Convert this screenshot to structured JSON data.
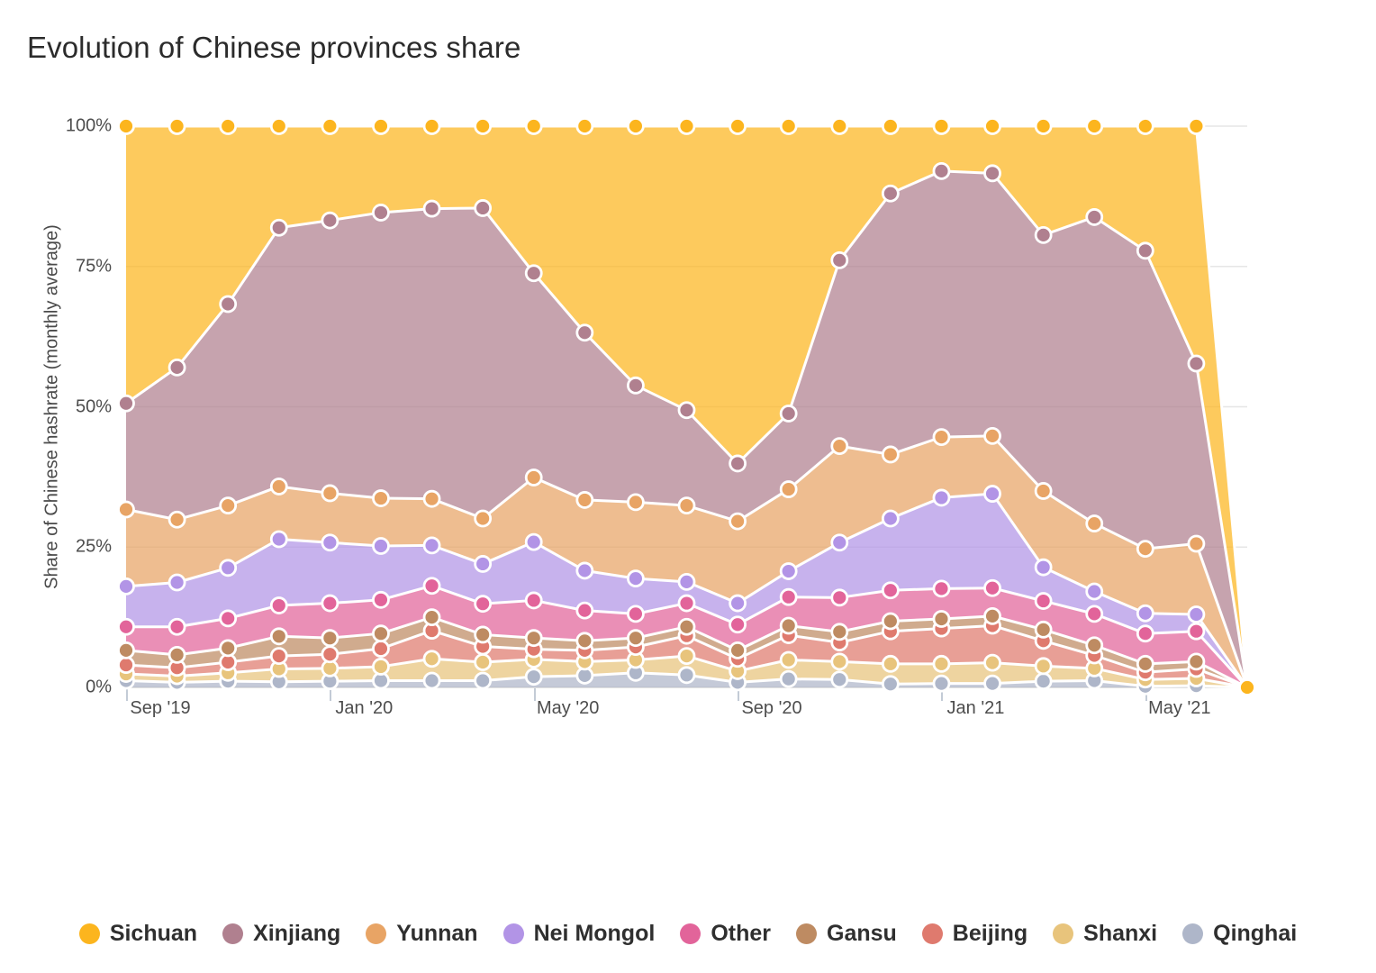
{
  "title": "Evolution of Chinese provinces share",
  "axes": {
    "y_title": "Share of Chinese hashrate (monthly average)",
    "y_ticks": [
      "0%",
      "25%",
      "50%",
      "75%",
      "100%"
    ],
    "x_ticks": [
      "Sep '19",
      "Jan '20",
      "May '20",
      "Sep '20",
      "Jan '21",
      "May '21"
    ]
  },
  "legend": [
    {
      "label": "Sichuan",
      "color": "#FCB51E"
    },
    {
      "label": "Xinjiang",
      "color": "#B0808F"
    },
    {
      "label": "Yunnan",
      "color": "#E8A465"
    },
    {
      "label": "Nei Mongol",
      "color": "#B294E6"
    },
    {
      "label": "Other",
      "color": "#E2649A"
    },
    {
      "label": "Gansu",
      "color": "#BE8B62"
    },
    {
      "label": "Beijing",
      "color": "#DF7A6E"
    },
    {
      "label": "Shanxi",
      "color": "#E8C47C"
    },
    {
      "label": "Qinghai",
      "color": "#AEB6C9"
    }
  ],
  "chart_data": {
    "type": "area",
    "stacked": true,
    "title": "Evolution of Chinese provinces share",
    "xlabel": "",
    "ylabel": "Share of Chinese hashrate (monthly average)",
    "ylim": [
      0,
      100
    ],
    "y_ticks": [
      0,
      25,
      50,
      75,
      100
    ],
    "grid": true,
    "legend_position": "bottom",
    "x": [
      "Sep '19",
      "Oct '19",
      "Nov '19",
      "Dec '19",
      "Jan '20",
      "Feb '20",
      "Mar '20",
      "Apr '20",
      "May '20",
      "Jun '20",
      "Jul '20",
      "Aug '20",
      "Sep '20",
      "Oct '20",
      "Nov '20",
      "Dec '20",
      "Jan '21",
      "Feb '21",
      "Mar '21",
      "Apr '21",
      "May '21",
      "Jun '21",
      "Jul '21"
    ],
    "stack_order_bottom_to_top": [
      "Qinghai",
      "Shanxi",
      "Beijing",
      "Gansu",
      "Other",
      "Nei Mongol",
      "Yunnan",
      "Xinjiang",
      "Sichuan"
    ],
    "series": [
      {
        "name": "Sichuan",
        "color": "#FCB51E",
        "values": [
          49.4,
          43.0,
          31.7,
          18.1,
          16.8,
          15.4,
          14.7,
          14.6,
          26.2,
          43.8,
          52.2,
          50.6,
          60.1,
          51.2,
          23.9,
          12.0,
          8.0,
          8.4,
          9.4,
          16.2,
          22.2,
          42.3,
          0.0
        ]
      },
      {
        "name": "Xinjiang",
        "color": "#B0808F",
        "values": [
          18.9,
          27.1,
          35.9,
          46.1,
          48.6,
          50.9,
          51.7,
          55.3,
          46.4,
          29.8,
          20.8,
          17.0,
          10.3,
          13.5,
          33.1,
          46.5,
          47.4,
          46.8,
          45.6,
          54.6,
          53.1,
          32.1,
          0.0
        ]
      },
      {
        "name": "Yunnan",
        "color": "#E8A465",
        "values": [
          13.7,
          11.2,
          11.1,
          9.4,
          8.8,
          8.5,
          8.3,
          8.1,
          11.5,
          12.6,
          13.6,
          13.6,
          14.6,
          14.6,
          17.2,
          11.4,
          10.8,
          10.3,
          13.6,
          12.1,
          11.5,
          12.6,
          0.0
        ]
      },
      {
        "name": "Nei Mongol",
        "color": "#B294E6",
        "values": [
          7.2,
          7.9,
          9.0,
          11.8,
          10.8,
          9.6,
          7.2,
          7.1,
          10.4,
          7.1,
          6.3,
          3.8,
          3.8,
          4.6,
          9.8,
          12.8,
          16.2,
          16.8,
          6.0,
          4.0,
          3.6,
          3.0,
          0.0
        ]
      },
      {
        "name": "Other",
        "color": "#E2649A",
        "values": [
          4.2,
          5.0,
          5.3,
          5.5,
          6.2,
          6.0,
          5.6,
          5.5,
          6.7,
          5.4,
          4.3,
          4.2,
          4.6,
          5.1,
          6.1,
          5.5,
          5.4,
          5.0,
          5.1,
          5.6,
          5.4,
          5.4,
          0.0
        ]
      },
      {
        "name": "Gansu",
        "color": "#BE8B62",
        "values": [
          2.6,
          2.3,
          2.5,
          3.5,
          2.9,
          2.7,
          2.4,
          2.1,
          2.0,
          1.7,
          1.6,
          1.6,
          1.5,
          1.7,
          1.9,
          1.8,
          1.7,
          1.7,
          2.0,
          1.8,
          1.5,
          1.3,
          0.0
        ]
      },
      {
        "name": "Beijing",
        "color": "#DF7A6E",
        "values": [
          1.6,
          1.5,
          1.9,
          2.3,
          2.5,
          3.2,
          5.0,
          2.8,
          1.8,
          2.0,
          2.3,
          3.6,
          2.2,
          4.4,
          3.4,
          5.8,
          6.3,
          6.6,
          4.5,
          2.3,
          1.3,
          1.7,
          0.0
        ]
      },
      {
        "name": "Shanxi",
        "color": "#E8C47C",
        "values": [
          1.2,
          1.1,
          1.5,
          2.3,
          2.3,
          2.5,
          3.9,
          3.3,
          3.1,
          2.5,
          2.3,
          3.4,
          2.0,
          3.4,
          3.2,
          3.6,
          3.5,
          3.7,
          2.7,
          2.2,
          1.2,
          1.3,
          0.0
        ]
      },
      {
        "name": "Qinghai",
        "color": "#AEB6C9",
        "values": [
          1.2,
          0.9,
          1.1,
          1.0,
          1.1,
          1.2,
          1.2,
          1.2,
          1.9,
          2.1,
          2.6,
          2.2,
          0.9,
          1.5,
          1.4,
          0.6,
          0.7,
          0.7,
          1.1,
          1.2,
          0.2,
          0.3,
          0.0
        ]
      }
    ],
    "cumulative_tops_percent": {
      "Qinghai": [
        1.2,
        0.9,
        1.1,
        1.0,
        1.1,
        1.2,
        1.2,
        1.2,
        1.9,
        2.1,
        2.6,
        2.2,
        0.9,
        1.5,
        1.4,
        0.6,
        0.7,
        0.7,
        1.1,
        1.2,
        0.2,
        0.3,
        0.0
      ],
      "Shanxi": [
        2.4,
        2.0,
        2.6,
        3.3,
        3.4,
        3.7,
        5.1,
        4.5,
        5.0,
        4.6,
        4.9,
        5.6,
        2.9,
        4.9,
        4.6,
        4.2,
        4.2,
        4.4,
        3.8,
        3.4,
        1.4,
        1.6,
        0.0
      ],
      "Beijing": [
        4.0,
        3.5,
        4.5,
        5.6,
        5.9,
        6.9,
        10.1,
        7.3,
        6.8,
        6.6,
        7.2,
        9.2,
        5.1,
        9.3,
        8.0,
        10.0,
        10.5,
        11.0,
        8.3,
        5.7,
        2.7,
        3.3,
        0.0
      ],
      "Gansu": [
        6.6,
        5.8,
        7.0,
        9.1,
        8.8,
        9.6,
        12.5,
        9.4,
        8.8,
        8.3,
        8.8,
        10.8,
        6.6,
        11.0,
        9.9,
        11.8,
        12.2,
        12.7,
        10.3,
        7.5,
        4.2,
        4.6,
        0.0
      ],
      "Other": [
        10.8,
        10.8,
        12.3,
        14.6,
        15.0,
        15.6,
        18.1,
        14.9,
        15.5,
        13.7,
        13.1,
        15.0,
        11.2,
        16.1,
        16.0,
        17.3,
        17.6,
        17.7,
        15.4,
        13.1,
        9.6,
        10.0,
        0.0
      ],
      "Nei Mongol": [
        18.0,
        18.7,
        21.3,
        26.4,
        25.8,
        25.2,
        25.3,
        22.0,
        25.9,
        20.8,
        19.4,
        18.8,
        15.0,
        20.7,
        25.8,
        30.1,
        33.8,
        34.5,
        21.4,
        17.1,
        13.2,
        13.0,
        0.0
      ],
      "Yunnan": [
        31.7,
        29.9,
        32.4,
        35.8,
        34.6,
        33.7,
        33.6,
        30.1,
        37.4,
        33.4,
        33.0,
        32.4,
        29.6,
        35.3,
        43.0,
        41.5,
        44.6,
        44.8,
        35.0,
        29.2,
        24.7,
        25.6,
        0.0
      ],
      "Xinjiang": [
        50.6,
        57.0,
        68.3,
        81.9,
        83.2,
        84.6,
        85.3,
        85.4,
        73.8,
        63.2,
        53.8,
        49.4,
        39.9,
        48.8,
        76.1,
        88.0,
        92.0,
        91.6,
        80.6,
        83.8,
        77.8,
        57.7,
        0.0
      ],
      "Sichuan": [
        100,
        100,
        100,
        100,
        100,
        100,
        100,
        100,
        100,
        100,
        100,
        100,
        100,
        100,
        100,
        100,
        100,
        100,
        100,
        100,
        100,
        100,
        0.0
      ]
    }
  }
}
